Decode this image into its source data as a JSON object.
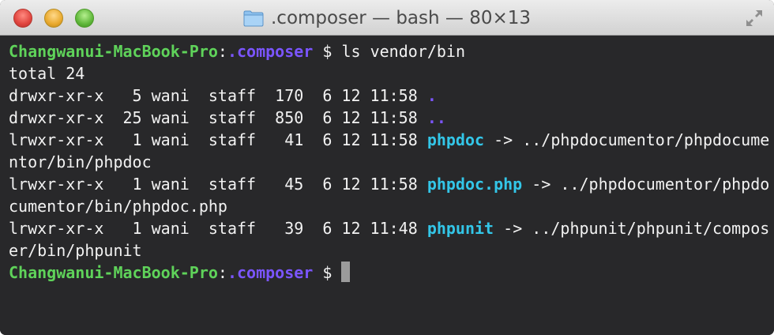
{
  "window": {
    "title": ".composer — bash — 80×13"
  },
  "terminal": {
    "prompt_host": "Changwanui-MacBook-Pro",
    "prompt_sep": ":",
    "prompt_dir": ".composer",
    "prompt_symbol": " $ ",
    "command": "ls vendor/bin",
    "total": "total 24",
    "entries": [
      {
        "meta": "drwxr-xr-x   5 wani  staff  170  6 12 11:58 ",
        "name": ".",
        "suffix": ""
      },
      {
        "meta": "drwxr-xr-x  25 wani  staff  850  6 12 11:58 ",
        "name": "..",
        "suffix": ""
      },
      {
        "meta": "lrwxr-xr-x   1 wani  staff   41  6 12 11:58 ",
        "name": "phpdoc",
        "suffix": " -> ../phpdocumentor/phpdocume",
        "wrap": "ntor/bin/phpdoc"
      },
      {
        "meta": "lrwxr-xr-x   1 wani  staff   45  6 12 11:58 ",
        "name": "phpdoc.php",
        "suffix": " -> ../phpdocumentor/phpdo",
        "wrap": "cumentor/bin/phpdoc.php"
      },
      {
        "meta": "lrwxr-xr-x   1 wani  staff   39  6 12 11:48 ",
        "name": "phpunit",
        "suffix": " -> ../phpunit/phpunit/compos",
        "wrap": "er/bin/phpunit"
      }
    ]
  },
  "colors": {
    "host": "#5fd35a",
    "directory": "#7b55ff",
    "symlink": "#33c6e8",
    "background": "#28282a"
  },
  "icons": {
    "folder": "folder-icon",
    "fullscreen": "fullscreen-icon"
  }
}
